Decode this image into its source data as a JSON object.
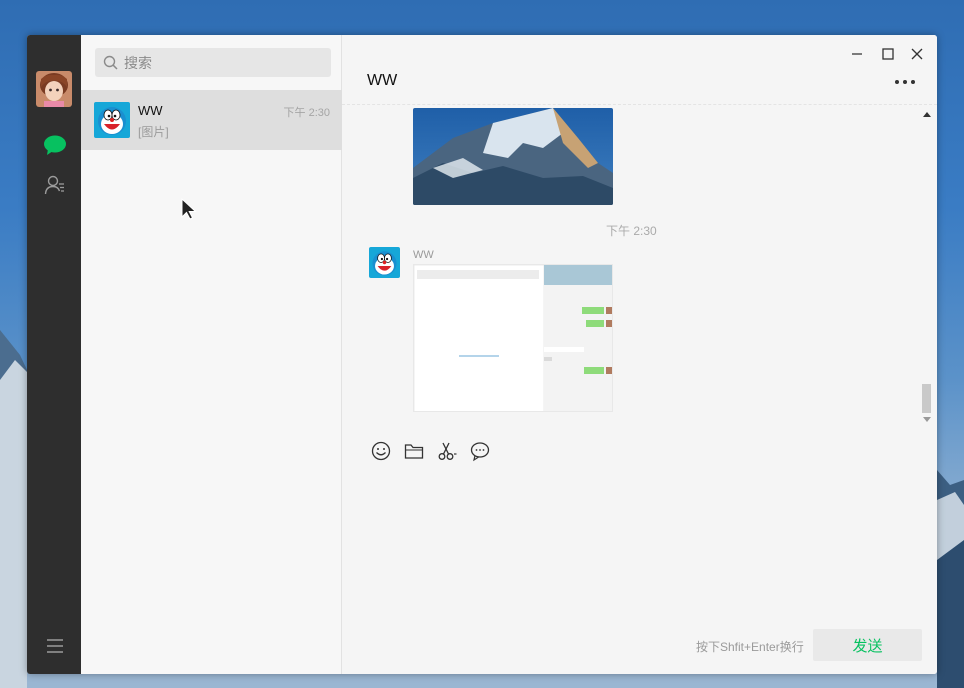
{
  "search": {
    "placeholder": "搜索"
  },
  "conversation": {
    "name": "WW",
    "time": "下午 2:30",
    "preview": "[图片]"
  },
  "chat": {
    "title": "WW",
    "messages": [
      {
        "type": "image",
        "description": "mountain photo"
      },
      {
        "type": "time",
        "text": "下午 2:30"
      },
      {
        "type": "image",
        "sender": "WW"
      }
    ],
    "time_text": "下午 2:30",
    "sender_name": "WW"
  },
  "composer": {
    "hint": "按下Shfit+Enter换行",
    "send_label": "发送"
  },
  "icons": {
    "nav": [
      "avatar",
      "chat-icon",
      "contacts-icon",
      "menu-icon"
    ],
    "toolbar": [
      "emoji-icon",
      "folder-icon",
      "scissors-icon",
      "bubble-icon"
    ],
    "window": [
      "minimize-icon",
      "maximize-icon",
      "close-icon"
    ]
  },
  "colors": {
    "accent": "#07c160",
    "nav_bg": "#2e2e2e",
    "selected": "#dedede"
  }
}
